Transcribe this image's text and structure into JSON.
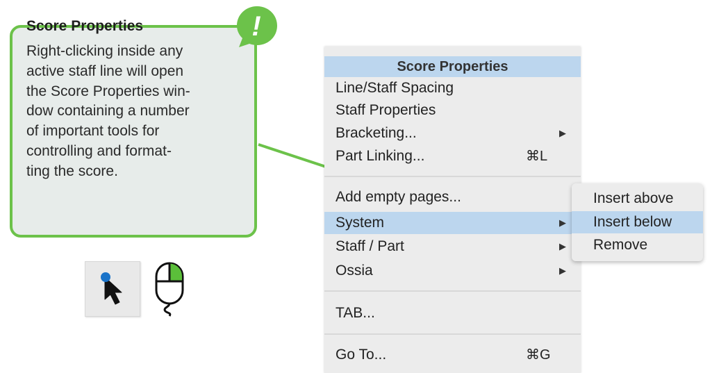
{
  "callout": {
    "title": "Score Properties",
    "lines": [
      "Right-clicking inside any",
      "active staff line will open",
      "the Score Properties win-",
      "dow containing a number",
      "of important tools for",
      "controlling and format-",
      "ting the score."
    ],
    "badge_glyph": "!"
  },
  "colors": {
    "accent_green": "#6cc24a",
    "callout_bg": "#e7ecea",
    "menu_bg": "#ececec",
    "selection": "#bcd6ee",
    "cursor_dot": "#1a73c9"
  },
  "icons": {
    "badge": "exclamation-icon",
    "cursor": "pointer-cursor-icon",
    "mouse": "mouse-right-click-icon"
  },
  "menu": {
    "header": "Score Properties",
    "items": [
      {
        "label": "Line/Staff Spacing",
        "shortcut": "",
        "submenu": false
      },
      {
        "label": "Staff Properties",
        "shortcut": "",
        "submenu": false
      },
      {
        "label": "Bracketing...",
        "shortcut": "",
        "submenu": true
      },
      {
        "label": "Part Linking...",
        "shortcut": "⌘L",
        "submenu": false
      },
      {
        "label": "Add empty pages...",
        "shortcut": "",
        "submenu": false
      },
      {
        "label": "System",
        "shortcut": "",
        "submenu": true,
        "selected": true
      },
      {
        "label": "Staff / Part",
        "shortcut": "",
        "submenu": true
      },
      {
        "label": "Ossia",
        "shortcut": "",
        "submenu": true
      },
      {
        "label": "TAB...",
        "shortcut": "",
        "submenu": false
      },
      {
        "label": "Go To...",
        "shortcut": "⌘G",
        "submenu": false
      }
    ],
    "submenu_arrow": "▶"
  },
  "submenu": {
    "items": [
      {
        "label": "Insert above"
      },
      {
        "label": "Insert below",
        "selected": true
      },
      {
        "label": "Remove"
      }
    ]
  }
}
